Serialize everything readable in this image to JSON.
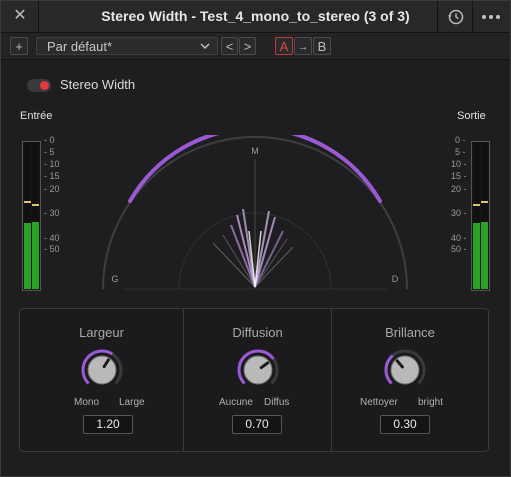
{
  "window": {
    "title": "Stereo Width - Test_4_mono_to_stereo (3 of 3)",
    "close_icon": "close-icon",
    "history_icon": "history-icon",
    "more_icon": "more-icon"
  },
  "preset_bar": {
    "add_label": "+",
    "preset_value": "Par défaut*",
    "prev_label": "<",
    "next_label": ">",
    "a_label": "A",
    "copy_label": "→",
    "b_label": "B"
  },
  "plugin": {
    "enabled": true,
    "name": "Stereo Width"
  },
  "input_meter": {
    "label": "Entrée",
    "levels": [
      0.45,
      0.46
    ],
    "peaks": [
      0.6,
      0.58
    ]
  },
  "output_meter": {
    "label": "Sortie",
    "levels": [
      0.45,
      0.46
    ],
    "peaks": [
      0.58,
      0.6
    ]
  },
  "meter_scale": [
    "0",
    "5",
    "10",
    "15",
    "20",
    "30",
    "40",
    "50"
  ],
  "goniometer": {
    "center_label": "M",
    "left_label": "G",
    "right_label": "D"
  },
  "controls": [
    {
      "name": "Largeur",
      "lo": "Mono",
      "hi": "Large",
      "value": "1.20",
      "position": 0.62
    },
    {
      "name": "Diffusion",
      "lo": "Aucune",
      "hi": "Diffus",
      "value": "0.70",
      "position": 0.7
    },
    {
      "name": "Brillance",
      "lo": "Nettoyer",
      "hi": "bright",
      "value": "0.30",
      "position": 0.35
    }
  ],
  "colors": {
    "accent": "#9b59d6",
    "meter_green": "#29a329",
    "enable_red": "#e23a3a"
  }
}
